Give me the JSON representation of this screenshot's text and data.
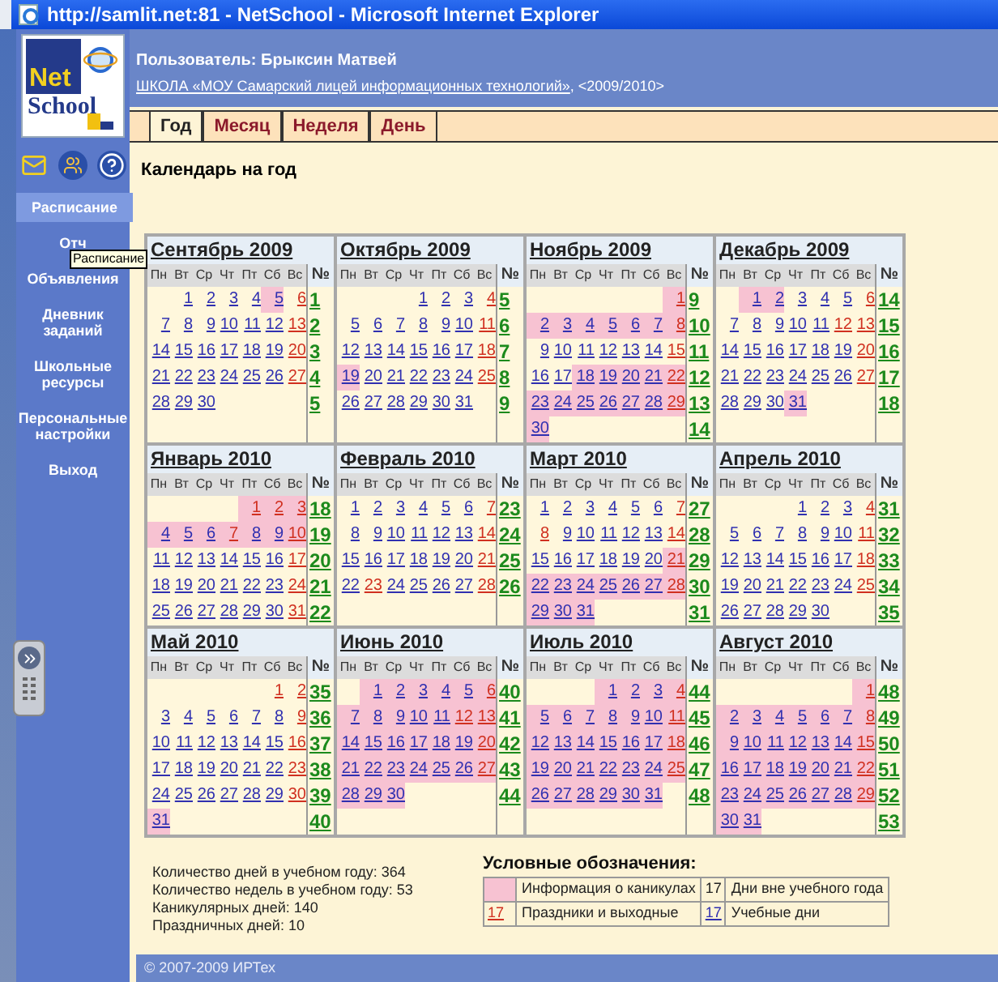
{
  "window": {
    "title": "http://samlit.net:81 - NetSchool - Microsoft Internet Explorer"
  },
  "logo": {
    "line_1": "Net",
    "line_2": "School"
  },
  "sidebar": {
    "items": [
      {
        "label": "Расписание",
        "selected": true
      },
      {
        "label": "Отч",
        "selected": false
      },
      {
        "label": "Объявления",
        "selected": false
      },
      {
        "label": "Дневник заданий",
        "selected": false
      },
      {
        "label": "Школьные ресурсы",
        "selected": false
      },
      {
        "label": "Персональные настройки",
        "selected": false
      },
      {
        "label": "Выход",
        "selected": false
      }
    ],
    "tooltip": "Расписание"
  },
  "header": {
    "user": "Пользователь: Брыксин Матвей",
    "school_link": "ШКОЛА «МОУ Самарский лицей информационных технологий»",
    "school_suffix": ", <2009/2010>"
  },
  "tabs": [
    {
      "label": "Год",
      "selected": true
    },
    {
      "label": "Месяц",
      "selected": false
    },
    {
      "label": "Неделя",
      "selected": false
    },
    {
      "label": "День",
      "selected": false
    }
  ],
  "page_title": "Календарь на год",
  "months": [
    {
      "title": "Сентябрь 2009",
      "weekdays": [
        "Пн",
        "Вт",
        "Ср",
        "Чт",
        "Пт",
        "Сб",
        "Вс"
      ],
      "week_header": "№",
      "weeks": [
        {
          "no": "1",
          "days": [
            "1",
            "2",
            "3",
            "4",
            "5",
            "6"
          ],
          "holiday": [
            false,
            false,
            false,
            false,
            false,
            true
          ],
          "vacation": [
            false,
            false,
            false,
            false,
            true,
            false
          ]
        },
        {
          "no": "2",
          "days": [
            "7",
            "8",
            "9",
            "10",
            "11",
            "12",
            "13"
          ],
          "holiday": [
            false,
            false,
            false,
            false,
            false,
            false,
            true
          ],
          "vacation": [
            false,
            false,
            false,
            false,
            false,
            false,
            false
          ]
        },
        {
          "no": "3",
          "days": [
            "14",
            "15",
            "16",
            "17",
            "18",
            "19",
            "20"
          ],
          "holiday": [
            false,
            false,
            false,
            false,
            false,
            false,
            true
          ],
          "vacation": [
            false,
            false,
            false,
            false,
            false,
            false,
            false
          ]
        },
        {
          "no": "4",
          "days": [
            "21",
            "22",
            "23",
            "24",
            "25",
            "26",
            "27"
          ],
          "holiday": [
            false,
            false,
            false,
            false,
            false,
            false,
            true
          ],
          "vacation": [
            false,
            false,
            false,
            false,
            false,
            false,
            false
          ]
        },
        {
          "no": "5",
          "days": [
            "28",
            "29",
            "30"
          ],
          "holiday": [
            false,
            false,
            false
          ],
          "vacation": [
            false,
            false,
            false
          ]
        }
      ]
    },
    {
      "title": "Октябрь 2009",
      "weekdays": [
        "Пн",
        "Вт",
        "Ср",
        "Чт",
        "Пт",
        "Сб",
        "Вс"
      ],
      "week_header": "№",
      "weeks": [
        {
          "no": "5",
          "days": [
            "1",
            "2",
            "3",
            "4"
          ],
          "holiday": [
            false,
            false,
            false,
            true
          ],
          "vacation": [
            false,
            false,
            false,
            false
          ]
        },
        {
          "no": "6",
          "days": [
            "5",
            "6",
            "7",
            "8",
            "9",
            "10",
            "11"
          ],
          "holiday": [
            false,
            false,
            false,
            false,
            false,
            false,
            true
          ],
          "vacation": [
            false,
            false,
            false,
            false,
            false,
            false,
            false
          ]
        },
        {
          "no": "7",
          "days": [
            "12",
            "13",
            "14",
            "15",
            "16",
            "17",
            "18"
          ],
          "holiday": [
            false,
            false,
            false,
            false,
            false,
            false,
            true
          ],
          "vacation": [
            false,
            false,
            false,
            false,
            false,
            false,
            false
          ]
        },
        {
          "no": "8",
          "days": [
            "19",
            "20",
            "21",
            "22",
            "23",
            "24",
            "25"
          ],
          "holiday": [
            false,
            false,
            false,
            false,
            false,
            false,
            true
          ],
          "vacation": [
            true,
            false,
            false,
            false,
            false,
            false,
            false
          ]
        },
        {
          "no": "9",
          "days": [
            "26",
            "27",
            "28",
            "29",
            "30",
            "31"
          ],
          "holiday": [
            false,
            false,
            false,
            false,
            false,
            false
          ],
          "vacation": [
            false,
            false,
            false,
            false,
            false,
            false
          ]
        }
      ]
    },
    {
      "title": "Ноябрь 2009",
      "weekdays": [
        "Пн",
        "Вт",
        "Ср",
        "Чт",
        "Пт",
        "Сб",
        "Вс"
      ],
      "week_header": "№",
      "weeks": [
        {
          "no": "9",
          "days": [
            "1"
          ],
          "holiday": [
            true
          ],
          "vacation": [
            true
          ]
        },
        {
          "no": "10",
          "days": [
            "2",
            "3",
            "4",
            "5",
            "6",
            "7",
            "8"
          ],
          "holiday": [
            false,
            false,
            false,
            false,
            false,
            false,
            true
          ],
          "vacation": [
            true,
            true,
            true,
            true,
            true,
            true,
            true
          ]
        },
        {
          "no": "11",
          "days": [
            "9",
            "10",
            "11",
            "12",
            "13",
            "14",
            "15"
          ],
          "holiday": [
            false,
            false,
            false,
            false,
            false,
            false,
            true
          ],
          "vacation": [
            false,
            false,
            false,
            false,
            false,
            false,
            false
          ]
        },
        {
          "no": "12",
          "days": [
            "16",
            "17",
            "18",
            "19",
            "20",
            "21",
            "22"
          ],
          "holiday": [
            false,
            false,
            false,
            false,
            false,
            false,
            true
          ],
          "vacation": [
            false,
            false,
            true,
            true,
            true,
            true,
            true
          ]
        },
        {
          "no": "13",
          "days": [
            "23",
            "24",
            "25",
            "26",
            "27",
            "28",
            "29"
          ],
          "holiday": [
            false,
            false,
            false,
            false,
            false,
            false,
            true
          ],
          "vacation": [
            true,
            true,
            true,
            true,
            true,
            true,
            true
          ]
        },
        {
          "no": "14",
          "days": [
            "30"
          ],
          "holiday": [
            false
          ],
          "vacation": [
            true
          ]
        }
      ]
    },
    {
      "title": "Декабрь 2009",
      "weekdays": [
        "Пн",
        "Вт",
        "Ср",
        "Чт",
        "Пт",
        "Сб",
        "Вс"
      ],
      "week_header": "№",
      "weeks": [
        {
          "no": "14",
          "days": [
            "1",
            "2",
            "3",
            "4",
            "5",
            "6"
          ],
          "holiday": [
            false,
            false,
            false,
            false,
            false,
            true
          ],
          "vacation": [
            true,
            true,
            false,
            false,
            false,
            false
          ]
        },
        {
          "no": "15",
          "days": [
            "7",
            "8",
            "9",
            "10",
            "11",
            "12",
            "13"
          ],
          "holiday": [
            false,
            false,
            false,
            false,
            false,
            true,
            true
          ],
          "vacation": [
            false,
            false,
            false,
            false,
            false,
            false,
            false
          ]
        },
        {
          "no": "16",
          "days": [
            "14",
            "15",
            "16",
            "17",
            "18",
            "19",
            "20"
          ],
          "holiday": [
            false,
            false,
            false,
            false,
            false,
            false,
            true
          ],
          "vacation": [
            false,
            false,
            false,
            false,
            false,
            false,
            false
          ]
        },
        {
          "no": "17",
          "days": [
            "21",
            "22",
            "23",
            "24",
            "25",
            "26",
            "27"
          ],
          "holiday": [
            false,
            false,
            false,
            false,
            false,
            false,
            true
          ],
          "vacation": [
            false,
            false,
            false,
            false,
            false,
            false,
            false
          ]
        },
        {
          "no": "18",
          "days": [
            "28",
            "29",
            "30",
            "31"
          ],
          "holiday": [
            false,
            false,
            false,
            false
          ],
          "vacation": [
            false,
            false,
            false,
            true
          ]
        }
      ]
    },
    {
      "title": "Январь 2010",
      "weekdays": [
        "Пн",
        "Вт",
        "Ср",
        "Чт",
        "Пт",
        "Сб",
        "Вс"
      ],
      "week_header": "№",
      "weeks": [
        {
          "no": "18",
          "days": [
            "1",
            "2",
            "3"
          ],
          "holiday": [
            true,
            true,
            true
          ],
          "vacation": [
            true,
            true,
            true
          ]
        },
        {
          "no": "19",
          "days": [
            "4",
            "5",
            "6",
            "7",
            "8",
            "9",
            "10"
          ],
          "holiday": [
            false,
            false,
            false,
            true,
            false,
            false,
            true
          ],
          "vacation": [
            true,
            true,
            true,
            true,
            true,
            true,
            true
          ]
        },
        {
          "no": "20",
          "days": [
            "11",
            "12",
            "13",
            "14",
            "15",
            "16",
            "17"
          ],
          "holiday": [
            false,
            false,
            false,
            false,
            false,
            false,
            true
          ],
          "vacation": [
            false,
            false,
            false,
            false,
            false,
            false,
            false
          ]
        },
        {
          "no": "21",
          "days": [
            "18",
            "19",
            "20",
            "21",
            "22",
            "23",
            "24"
          ],
          "holiday": [
            false,
            false,
            false,
            false,
            false,
            false,
            true
          ],
          "vacation": [
            false,
            false,
            false,
            false,
            false,
            false,
            false
          ]
        },
        {
          "no": "22",
          "days": [
            "25",
            "26",
            "27",
            "28",
            "29",
            "30",
            "31"
          ],
          "holiday": [
            false,
            false,
            false,
            false,
            false,
            false,
            true
          ],
          "vacation": [
            false,
            false,
            false,
            false,
            false,
            false,
            false
          ]
        }
      ]
    },
    {
      "title": "Февраль 2010",
      "weekdays": [
        "Пн",
        "Вт",
        "Ср",
        "Чт",
        "Пт",
        "Сб",
        "Вс"
      ],
      "week_header": "№",
      "weeks": [
        {
          "no": "23",
          "days": [
            "1",
            "2",
            "3",
            "4",
            "5",
            "6",
            "7"
          ],
          "holiday": [
            false,
            false,
            false,
            false,
            false,
            false,
            true
          ],
          "vacation": [
            false,
            false,
            false,
            false,
            false,
            false,
            false
          ]
        },
        {
          "no": "24",
          "days": [
            "8",
            "9",
            "10",
            "11",
            "12",
            "13",
            "14"
          ],
          "holiday": [
            false,
            false,
            false,
            false,
            false,
            false,
            true
          ],
          "vacation": [
            false,
            false,
            false,
            false,
            false,
            false,
            false
          ]
        },
        {
          "no": "25",
          "days": [
            "15",
            "16",
            "17",
            "18",
            "19",
            "20",
            "21"
          ],
          "holiday": [
            false,
            false,
            false,
            false,
            false,
            false,
            true
          ],
          "vacation": [
            false,
            false,
            false,
            false,
            false,
            false,
            false
          ]
        },
        {
          "no": "26",
          "days": [
            "22",
            "23",
            "24",
            "25",
            "26",
            "27",
            "28"
          ],
          "holiday": [
            false,
            true,
            false,
            false,
            false,
            false,
            true
          ],
          "vacation": [
            false,
            false,
            false,
            false,
            false,
            false,
            false
          ]
        }
      ]
    },
    {
      "title": "Март 2010",
      "weekdays": [
        "Пн",
        "Вт",
        "Ср",
        "Чт",
        "Пт",
        "Сб",
        "Вс"
      ],
      "week_header": "№",
      "weeks": [
        {
          "no": "27",
          "days": [
            "1",
            "2",
            "3",
            "4",
            "5",
            "6",
            "7"
          ],
          "holiday": [
            false,
            false,
            false,
            false,
            false,
            false,
            true
          ],
          "vacation": [
            false,
            false,
            false,
            false,
            false,
            false,
            false
          ]
        },
        {
          "no": "28",
          "days": [
            "8",
            "9",
            "10",
            "11",
            "12",
            "13",
            "14"
          ],
          "holiday": [
            true,
            false,
            false,
            false,
            false,
            false,
            true
          ],
          "vacation": [
            false,
            false,
            false,
            false,
            false,
            false,
            false
          ]
        },
        {
          "no": "29",
          "days": [
            "15",
            "16",
            "17",
            "18",
            "19",
            "20",
            "21"
          ],
          "holiday": [
            false,
            false,
            false,
            false,
            false,
            false,
            true
          ],
          "vacation": [
            false,
            false,
            false,
            false,
            false,
            false,
            true
          ]
        },
        {
          "no": "30",
          "days": [
            "22",
            "23",
            "24",
            "25",
            "26",
            "27",
            "28"
          ],
          "holiday": [
            false,
            false,
            false,
            false,
            false,
            false,
            true
          ],
          "vacation": [
            true,
            true,
            true,
            true,
            true,
            true,
            true
          ]
        },
        {
          "no": "31",
          "days": [
            "29",
            "30",
            "31"
          ],
          "holiday": [
            false,
            false,
            false
          ],
          "vacation": [
            true,
            true,
            true
          ]
        }
      ]
    },
    {
      "title": "Апрель 2010",
      "weekdays": [
        "Пн",
        "Вт",
        "Ср",
        "Чт",
        "Пт",
        "Сб",
        "Вс"
      ],
      "week_header": "№",
      "weeks": [
        {
          "no": "31",
          "days": [
            "1",
            "2",
            "3",
            "4"
          ],
          "holiday": [
            false,
            false,
            false,
            true
          ],
          "vacation": [
            false,
            false,
            false,
            false
          ]
        },
        {
          "no": "32",
          "days": [
            "5",
            "6",
            "7",
            "8",
            "9",
            "10",
            "11"
          ],
          "holiday": [
            false,
            false,
            false,
            false,
            false,
            false,
            true
          ],
          "vacation": [
            false,
            false,
            false,
            false,
            false,
            false,
            false
          ]
        },
        {
          "no": "33",
          "days": [
            "12",
            "13",
            "14",
            "15",
            "16",
            "17",
            "18"
          ],
          "holiday": [
            false,
            false,
            false,
            false,
            false,
            false,
            true
          ],
          "vacation": [
            false,
            false,
            false,
            false,
            false,
            false,
            false
          ]
        },
        {
          "no": "34",
          "days": [
            "19",
            "20",
            "21",
            "22",
            "23",
            "24",
            "25"
          ],
          "holiday": [
            false,
            false,
            false,
            false,
            false,
            false,
            true
          ],
          "vacation": [
            false,
            false,
            false,
            false,
            false,
            false,
            false
          ]
        },
        {
          "no": "35",
          "days": [
            "26",
            "27",
            "28",
            "29",
            "30"
          ],
          "holiday": [
            false,
            false,
            false,
            false,
            false
          ],
          "vacation": [
            false,
            false,
            false,
            false,
            false
          ]
        }
      ]
    },
    {
      "title": "Май 2010",
      "weekdays": [
        "Пн",
        "Вт",
        "Ср",
        "Чт",
        "Пт",
        "Сб",
        "Вс"
      ],
      "week_header": "№",
      "weeks": [
        {
          "no": "35",
          "days": [
            "1",
            "2"
          ],
          "holiday": [
            true,
            true
          ],
          "vacation": [
            false,
            false
          ]
        },
        {
          "no": "36",
          "days": [
            "3",
            "4",
            "5",
            "6",
            "7",
            "8",
            "9"
          ],
          "holiday": [
            false,
            false,
            false,
            false,
            false,
            false,
            true
          ],
          "vacation": [
            false,
            false,
            false,
            false,
            false,
            false,
            false
          ]
        },
        {
          "no": "37",
          "days": [
            "10",
            "11",
            "12",
            "13",
            "14",
            "15",
            "16"
          ],
          "holiday": [
            false,
            false,
            false,
            false,
            false,
            false,
            true
          ],
          "vacation": [
            false,
            false,
            false,
            false,
            false,
            false,
            false
          ]
        },
        {
          "no": "38",
          "days": [
            "17",
            "18",
            "19",
            "20",
            "21",
            "22",
            "23"
          ],
          "holiday": [
            false,
            false,
            false,
            false,
            false,
            false,
            true
          ],
          "vacation": [
            false,
            false,
            false,
            false,
            false,
            false,
            false
          ]
        },
        {
          "no": "39",
          "days": [
            "24",
            "25",
            "26",
            "27",
            "28",
            "29",
            "30"
          ],
          "holiday": [
            false,
            false,
            false,
            false,
            false,
            false,
            true
          ],
          "vacation": [
            false,
            false,
            false,
            false,
            false,
            false,
            false
          ]
        },
        {
          "no": "40",
          "days": [
            "31"
          ],
          "holiday": [
            false
          ],
          "vacation": [
            true
          ]
        }
      ]
    },
    {
      "title": "Июнь 2010",
      "weekdays": [
        "Пн",
        "Вт",
        "Ср",
        "Чт",
        "Пт",
        "Сб",
        "Вс"
      ],
      "week_header": "№",
      "weeks": [
        {
          "no": "40",
          "days": [
            "1",
            "2",
            "3",
            "4",
            "5",
            "6"
          ],
          "holiday": [
            false,
            false,
            false,
            false,
            false,
            true
          ],
          "vacation": [
            true,
            true,
            true,
            true,
            true,
            true
          ]
        },
        {
          "no": "41",
          "days": [
            "7",
            "8",
            "9",
            "10",
            "11",
            "12",
            "13"
          ],
          "holiday": [
            false,
            false,
            false,
            false,
            false,
            true,
            true
          ],
          "vacation": [
            true,
            true,
            true,
            true,
            true,
            true,
            true
          ]
        },
        {
          "no": "42",
          "days": [
            "14",
            "15",
            "16",
            "17",
            "18",
            "19",
            "20"
          ],
          "holiday": [
            false,
            false,
            false,
            false,
            false,
            false,
            true
          ],
          "vacation": [
            true,
            true,
            true,
            true,
            true,
            true,
            true
          ]
        },
        {
          "no": "43",
          "days": [
            "21",
            "22",
            "23",
            "24",
            "25",
            "26",
            "27"
          ],
          "holiday": [
            false,
            false,
            false,
            false,
            false,
            false,
            true
          ],
          "vacation": [
            true,
            true,
            true,
            true,
            true,
            true,
            true
          ]
        },
        {
          "no": "44",
          "days": [
            "28",
            "29",
            "30"
          ],
          "holiday": [
            false,
            false,
            false
          ],
          "vacation": [
            true,
            true,
            true
          ]
        }
      ]
    },
    {
      "title": "Июль 2010",
      "weekdays": [
        "Пн",
        "Вт",
        "Ср",
        "Чт",
        "Пт",
        "Сб",
        "Вс"
      ],
      "week_header": "№",
      "weeks": [
        {
          "no": "44",
          "days": [
            "1",
            "2",
            "3",
            "4"
          ],
          "holiday": [
            false,
            false,
            false,
            true
          ],
          "vacation": [
            true,
            true,
            true,
            true
          ]
        },
        {
          "no": "45",
          "days": [
            "5",
            "6",
            "7",
            "8",
            "9",
            "10",
            "11"
          ],
          "holiday": [
            false,
            false,
            false,
            false,
            false,
            false,
            true
          ],
          "vacation": [
            true,
            true,
            true,
            true,
            true,
            true,
            true
          ]
        },
        {
          "no": "46",
          "days": [
            "12",
            "13",
            "14",
            "15",
            "16",
            "17",
            "18"
          ],
          "holiday": [
            false,
            false,
            false,
            false,
            false,
            false,
            true
          ],
          "vacation": [
            true,
            true,
            true,
            true,
            true,
            true,
            true
          ]
        },
        {
          "no": "47",
          "days": [
            "19",
            "20",
            "21",
            "22",
            "23",
            "24",
            "25"
          ],
          "holiday": [
            false,
            false,
            false,
            false,
            false,
            false,
            true
          ],
          "vacation": [
            true,
            true,
            true,
            true,
            true,
            true,
            true
          ]
        },
        {
          "no": "48",
          "days": [
            "26",
            "27",
            "28",
            "29",
            "30",
            "31"
          ],
          "holiday": [
            false,
            false,
            false,
            false,
            false,
            false
          ],
          "vacation": [
            true,
            true,
            true,
            true,
            true,
            true
          ]
        }
      ]
    },
    {
      "title": "Август 2010",
      "weekdays": [
        "Пн",
        "Вт",
        "Ср",
        "Чт",
        "Пт",
        "Сб",
        "Вс"
      ],
      "week_header": "№",
      "weeks": [
        {
          "no": "48",
          "days": [
            "1"
          ],
          "holiday": [
            true
          ],
          "vacation": [
            true
          ]
        },
        {
          "no": "49",
          "days": [
            "2",
            "3",
            "4",
            "5",
            "6",
            "7",
            "8"
          ],
          "holiday": [
            false,
            false,
            false,
            false,
            false,
            false,
            true
          ],
          "vacation": [
            true,
            true,
            true,
            true,
            true,
            true,
            true
          ]
        },
        {
          "no": "50",
          "days": [
            "9",
            "10",
            "11",
            "12",
            "13",
            "14",
            "15"
          ],
          "holiday": [
            false,
            false,
            false,
            false,
            false,
            false,
            true
          ],
          "vacation": [
            true,
            true,
            true,
            true,
            true,
            true,
            true
          ]
        },
        {
          "no": "51",
          "days": [
            "16",
            "17",
            "18",
            "19",
            "20",
            "21",
            "22"
          ],
          "holiday": [
            false,
            false,
            false,
            false,
            false,
            false,
            true
          ],
          "vacation": [
            true,
            true,
            true,
            true,
            true,
            true,
            true
          ]
        },
        {
          "no": "52",
          "days": [
            "23",
            "24",
            "25",
            "26",
            "27",
            "28",
            "29"
          ],
          "holiday": [
            false,
            false,
            false,
            false,
            false,
            false,
            true
          ],
          "vacation": [
            true,
            true,
            true,
            true,
            true,
            true,
            true
          ]
        },
        {
          "no": "53",
          "days": [
            "30",
            "31"
          ],
          "holiday": [
            false,
            false
          ],
          "vacation": [
            true,
            true
          ]
        }
      ]
    }
  ],
  "stats": [
    "Количество дней в учебном году: 364",
    "Количество недель в учебном году: 53",
    "Каникулярных дней: 140",
    "Праздничных дней: 10"
  ],
  "legend": {
    "title": "Условные обозначения:",
    "items": [
      {
        "kind": "vacation",
        "label": "Информация о каникулах"
      },
      {
        "kind": "outside",
        "sample": "17",
        "label": "Дни вне учебного года"
      },
      {
        "kind": "holiday",
        "sample": "17",
        "label": "Праздники и выходные"
      },
      {
        "kind": "school",
        "sample": "17",
        "label": "Учебные дни"
      }
    ]
  },
  "footer": "© 2007-2009 ИРТех"
}
